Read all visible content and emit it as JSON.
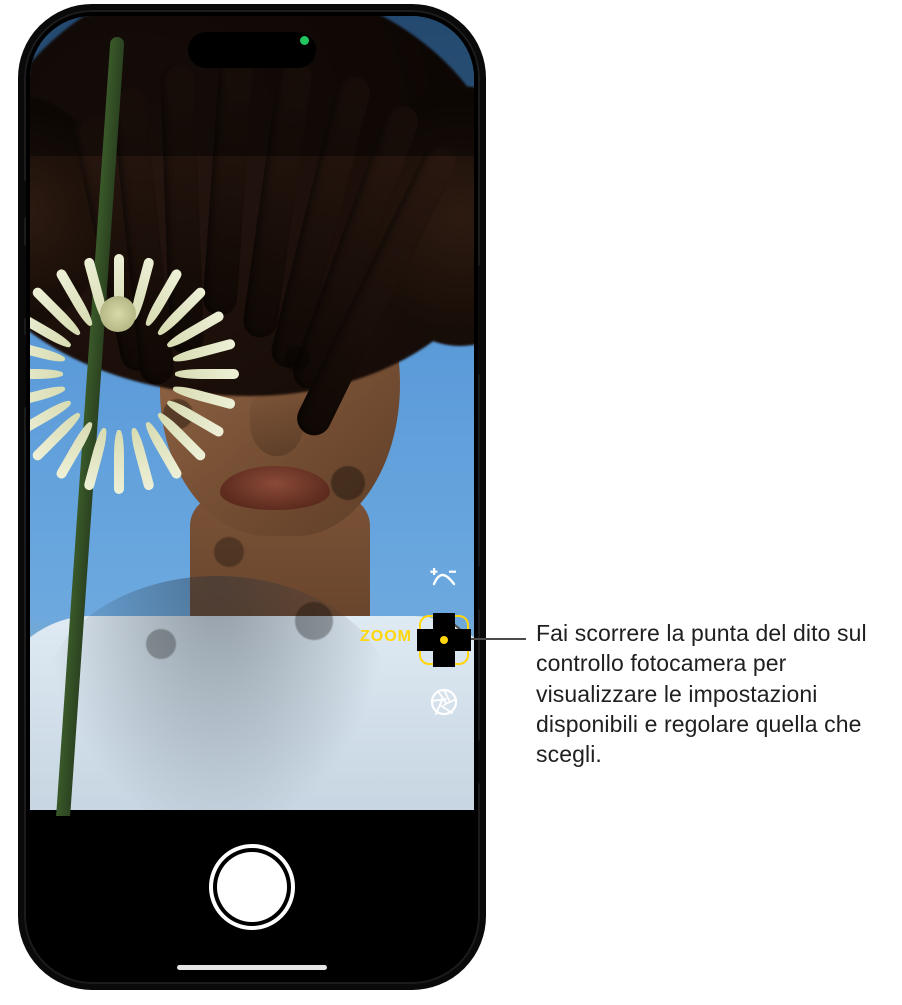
{
  "camera": {
    "zoom_label": "ZOOM",
    "controls": {
      "exposure": {
        "name": "exposure-icon"
      },
      "zoom": {
        "name": "zoom-selector-icon",
        "selected": true
      },
      "aperture": {
        "name": "aperture-icon"
      }
    }
  },
  "callout": {
    "text": "Fai scorrere la punta del dito sul controllo fotocamera per visualizzare le impostazioni disponibili e regolare quella che scegli."
  }
}
